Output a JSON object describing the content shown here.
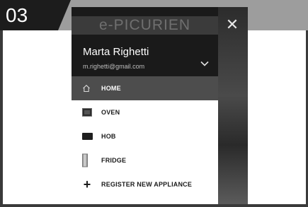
{
  "step": {
    "number": "03"
  },
  "app": {
    "logo": "e-PICURIEN",
    "close_glyph": "✕"
  },
  "user": {
    "name": "Marta Righetti",
    "email": "m.righetti@gmail.com"
  },
  "menu": {
    "items": [
      {
        "label": "HOME",
        "icon": "home-icon",
        "active": true
      },
      {
        "label": "OVEN",
        "icon": "oven-icon",
        "active": false
      },
      {
        "label": "HOB",
        "icon": "hob-icon",
        "active": false
      },
      {
        "label": "FRIDGE",
        "icon": "fridge-icon",
        "active": false
      },
      {
        "label": "REGISTER NEW APPLIANCE",
        "icon": "plus-icon",
        "active": false
      }
    ]
  },
  "colors": {
    "active_item": "#4d4d4d",
    "header": "#1a1a1a",
    "frame": "#9d9d9d"
  }
}
